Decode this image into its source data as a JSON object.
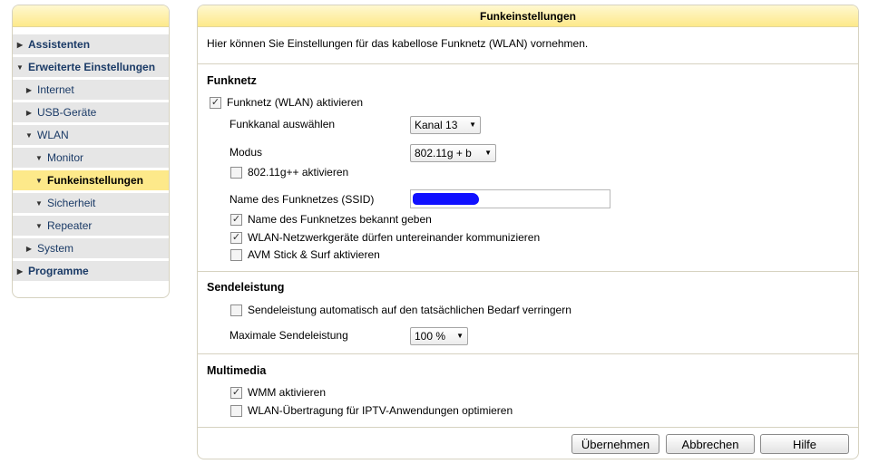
{
  "sidebar": {
    "items": [
      {
        "label": "Assistenten"
      },
      {
        "label": "Erweiterte Einstellungen"
      },
      {
        "label": "Internet"
      },
      {
        "label": "USB-Geräte"
      },
      {
        "label": "WLAN"
      },
      {
        "label": "Monitor"
      },
      {
        "label": "Funkeinstellungen"
      },
      {
        "label": "Sicherheit"
      },
      {
        "label": "Repeater"
      },
      {
        "label": "System"
      },
      {
        "label": "Programme"
      }
    ]
  },
  "panel": {
    "title": "Funkeinstellungen",
    "intro": "Hier können Sie Einstellungen für das kabellose Funknetz (WLAN) vornehmen."
  },
  "funknetz": {
    "heading": "Funknetz",
    "enable_label": "Funknetz (WLAN) aktivieren",
    "channel_label": "Funkkanal auswählen",
    "channel_value": "Kanal 13",
    "mode_label": "Modus",
    "mode_value": "802.11g + b",
    "gpp_label": "802.11g++ aktivieren",
    "ssid_label": "Name des Funknetzes (SSID)",
    "ssid_broadcast_label": "Name des Funknetzes bekannt geben",
    "intra_label": "WLAN-Netzwerkgeräte dürfen untereinander kommunizieren",
    "stick_label": "AVM Stick & Surf aktivieren"
  },
  "sendeleistung": {
    "heading": "Sendeleistung",
    "auto_label": "Sendeleistung automatisch auf den tatsächlichen Bedarf verringern",
    "max_label": "Maximale Sendeleistung",
    "max_value": "100 %"
  },
  "multimedia": {
    "heading": "Multimedia",
    "wmm_label": "WMM aktivieren",
    "iptv_label": "WLAN-Übertragung für IPTV-Anwendungen optimieren"
  },
  "buttons": {
    "apply": "Übernehmen",
    "cancel": "Abbrechen",
    "help": "Hilfe"
  },
  "checked_mark": "✓"
}
